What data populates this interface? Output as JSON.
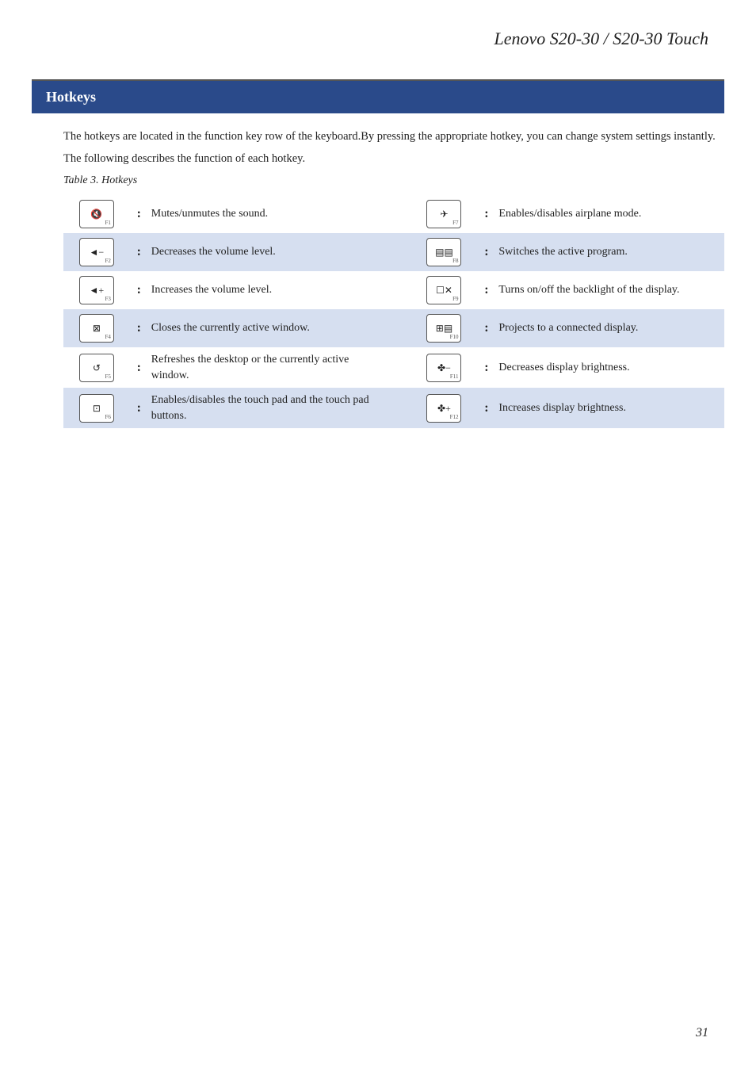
{
  "page": {
    "title": "Lenovo S20-30 / S20-30 Touch",
    "page_number": "31"
  },
  "section": {
    "heading": "Hotkeys"
  },
  "intro": {
    "line1": "The hotkeys are located in the function key row of the keyboard.By pressing the appropriate hotkey, you can change system settings instantly.",
    "line2": "The following describes the function of each hotkey.",
    "table_caption": "Table 3. Hotkeys"
  },
  "hotkeys": [
    {
      "left": {
        "symbol": "🔇",
        "fn": "F1",
        "description": "Mutes/unmutes the sound."
      },
      "right": {
        "symbol": "✈",
        "fn": "F7",
        "description": "Enables/disables airplane mode."
      },
      "shaded": false
    },
    {
      "left": {
        "symbol": "◁−",
        "fn": "F2",
        "description": "Decreases the volume level."
      },
      "right": {
        "symbol": "▤▤",
        "fn": "F8",
        "description": "Switches the active program."
      },
      "shaded": true
    },
    {
      "left": {
        "symbol": "◁+",
        "fn": "F3",
        "description": "Increases the volume level."
      },
      "right": {
        "symbol": "☐✕",
        "fn": "F9",
        "description": "Turns on/off the backlight of the display."
      },
      "shaded": false
    },
    {
      "left": {
        "symbol": "⊠",
        "fn": "F4",
        "description": "Closes the currently active window."
      },
      "right": {
        "symbol": "☐▤",
        "fn": "F10",
        "description": "Projects to a connected display."
      },
      "shaded": true
    },
    {
      "left": {
        "symbol": "↺",
        "fn": "F5",
        "description": "Refreshes the desktop or the currently active window."
      },
      "right": {
        "symbol": "✿−",
        "fn": "F11",
        "description": "Decreases display brightness."
      },
      "shaded": false
    },
    {
      "left": {
        "symbol": "⊡",
        "fn": "F6",
        "description": "Enables/disables the touch pad and the touch pad buttons."
      },
      "right": {
        "symbol": "✿+",
        "fn": "F12",
        "description": "Increases display brightness."
      },
      "shaded": true
    }
  ]
}
